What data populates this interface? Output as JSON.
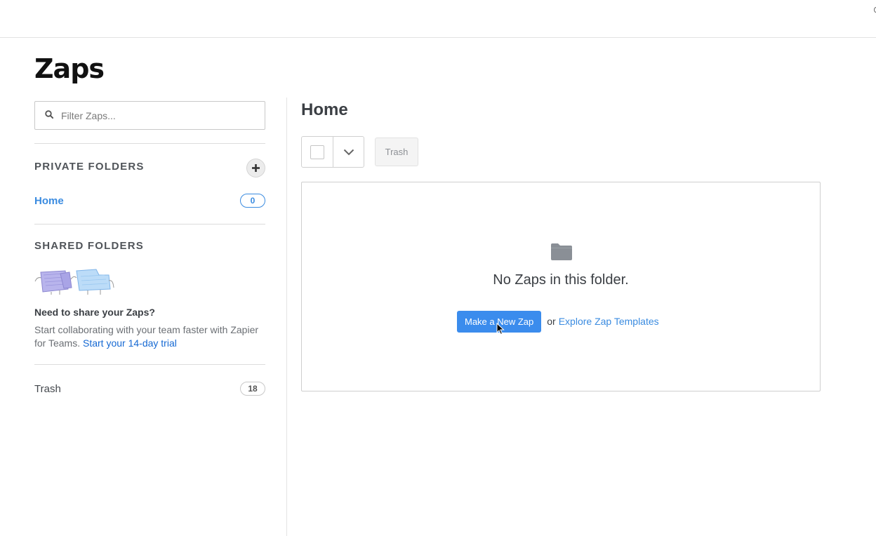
{
  "page": {
    "title": "Zaps"
  },
  "sidebar": {
    "filter_placeholder": "Filter Zaps...",
    "private_folders": {
      "title": "PRIVATE FOLDERS",
      "add_icon": "plus-icon",
      "items": [
        {
          "label": "Home",
          "count": "0",
          "active": true
        }
      ]
    },
    "shared_folders": {
      "title": "SHARED FOLDERS",
      "question": "Need to share your Zaps?",
      "text": "Start collaborating with your team faster with Zapier for Teams.",
      "trial_link": "Start your 14-day trial"
    },
    "trash": {
      "label": "Trash",
      "count": "18"
    }
  },
  "main": {
    "title": "Home",
    "toolbar": {
      "trash_label": "Trash",
      "dropdown_icon": "chevron-down-icon"
    },
    "empty": {
      "message": "No Zaps in this folder.",
      "new_zap_label": "Make a New Zap",
      "or_text": "or",
      "explore_link": "Explore Zap Templates",
      "folder_icon": "folder-icon"
    }
  },
  "colors": {
    "accent": "#3a8be0",
    "button": "#3b8ced",
    "link": "#1669d3"
  }
}
